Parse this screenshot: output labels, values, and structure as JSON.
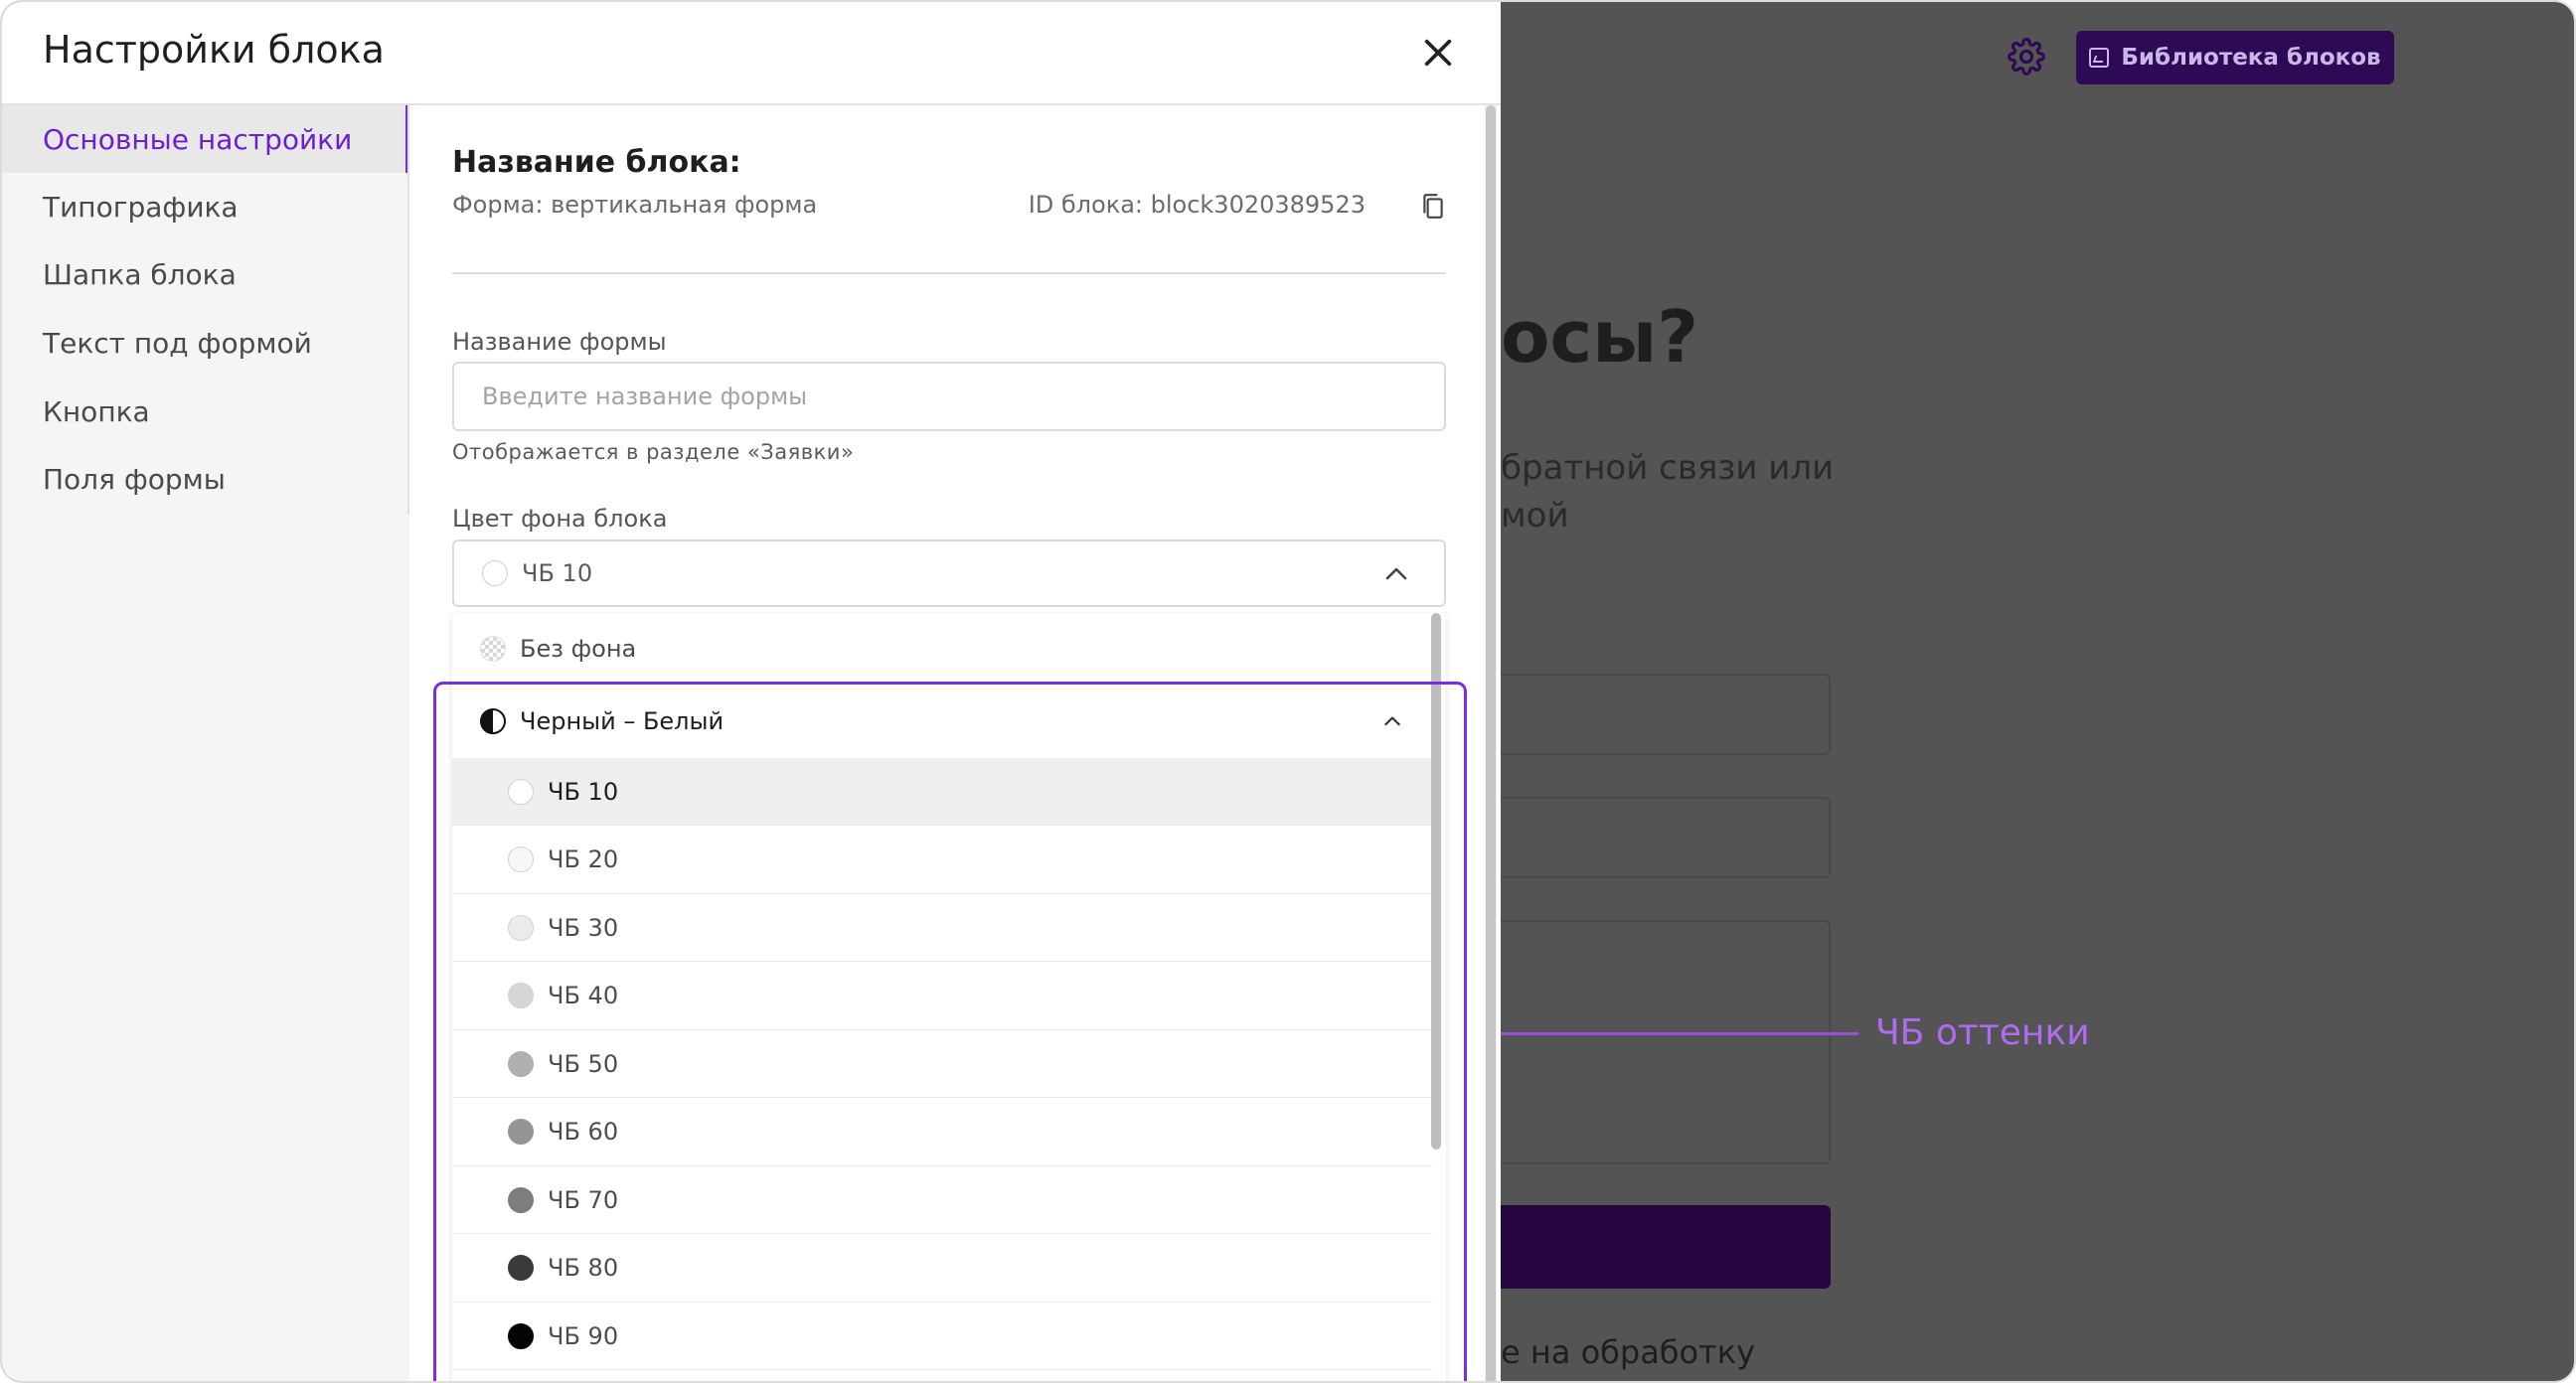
{
  "modal": {
    "title": "Настройки блока"
  },
  "sidebar": {
    "items": [
      {
        "label": "Основные настройки",
        "active": true
      },
      {
        "label": "Типографика"
      },
      {
        "label": "Шапка блока"
      },
      {
        "label": "Текст под формой"
      },
      {
        "label": "Кнопка"
      },
      {
        "label": "Поля формы"
      }
    ]
  },
  "content": {
    "section_title": "Название блока:",
    "form_type": "Форма: вертикальная форма",
    "block_id": "ID блока: block3020389523",
    "form_name_label": "Название формы",
    "form_name_placeholder": "Введите название формы",
    "form_name_value": "",
    "form_name_hint": "Отображается в разделе «Заявки»",
    "bg_color_label": "Цвет фона блока",
    "bg_color_selected": "ЧБ 10",
    "bg_color_selected_swatch": "#ffffff"
  },
  "dropdown": {
    "no_bg_label": "Без фона",
    "group_label": "Черный – Белый",
    "options": [
      {
        "label": "ЧБ 10",
        "color": "#ffffff",
        "selected": true
      },
      {
        "label": "ЧБ 20",
        "color": "#f7f7f7"
      },
      {
        "label": "ЧБ 30",
        "color": "#ececec"
      },
      {
        "label": "ЧБ 40",
        "color": "#d6d6d6"
      },
      {
        "label": "ЧБ 50",
        "color": "#b0b0b0"
      },
      {
        "label": "ЧБ 60",
        "color": "#959595"
      },
      {
        "label": "ЧБ 70",
        "color": "#7d7d7d"
      },
      {
        "label": "ЧБ 80",
        "color": "#3a3a3a"
      },
      {
        "label": "ЧБ 90",
        "color": "#050505"
      }
    ]
  },
  "annotation": {
    "label": "ЧБ оттенки",
    "color": "#b06cf0"
  },
  "background_page": {
    "library_button_label": "Библиотека блоков",
    "heading_fragment": "осы?",
    "subtext_fragment": "братной связи или\nмой",
    "consent_fragment": "е на обработку"
  },
  "colors": {
    "accent": "#7a2ce0",
    "active_text": "#6b1fd1",
    "dark_button": "#2c0a55"
  }
}
